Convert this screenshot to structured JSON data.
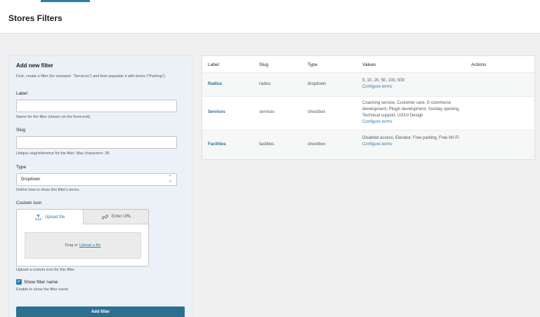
{
  "header": {
    "title": "Stores Filters"
  },
  "form": {
    "heading": "Add new filter",
    "intro": "First, create a filter (for example: \"Services\") and then populate it with terms (\"Parking\").",
    "label": {
      "title": "Label",
      "value": "",
      "help": "Name for the filter (shown on the front-end)."
    },
    "slug": {
      "title": "Slug",
      "value": "",
      "help": "Unique slug/reference for the filter. Max characters: 28."
    },
    "type": {
      "title": "Type",
      "selected": "Dropdown",
      "help": "Define how to show this filter's terms."
    },
    "icon": {
      "title": "Custom icon",
      "tab_upload": "Upload file",
      "tab_url": "Enter URL",
      "drop_text": "Drag or",
      "drop_link": "Upload a file",
      "help": "Upload a custom icon for this filter."
    },
    "show_name": {
      "checked": true,
      "label": "Show filter name",
      "help": "Enable to show the filter name."
    },
    "submit_label": "Add filter"
  },
  "table": {
    "columns": {
      "label": "Label",
      "slug": "Slug",
      "type": "Type",
      "values": "Values",
      "actions": "Actions"
    },
    "configure_label": "Configure terms",
    "rows": [
      {
        "label": "Radius",
        "slug": "radius",
        "type": "dropdown",
        "values": "5, 10, 20, 50, 100, 500"
      },
      {
        "label": "Services",
        "slug": "services",
        "type": "checkbox",
        "values": "Coaching service, Customer care, E-commerce development, Plugin development, Sunday opening, Technical support, UX/UI Design"
      },
      {
        "label": "Facilities",
        "slug": "facilities",
        "type": "checkbox",
        "values": "Disabled access, Elevator, Free parking, Free WI-FI"
      }
    ]
  },
  "colors": {
    "accent": "#2c7ea8",
    "button": "#2c6f91",
    "panel": "#ebf1f6"
  },
  "icons": {
    "upload": "upload-icon",
    "link": "link-icon",
    "select": "chevron-updown-icon",
    "check": "checkmark-icon"
  }
}
